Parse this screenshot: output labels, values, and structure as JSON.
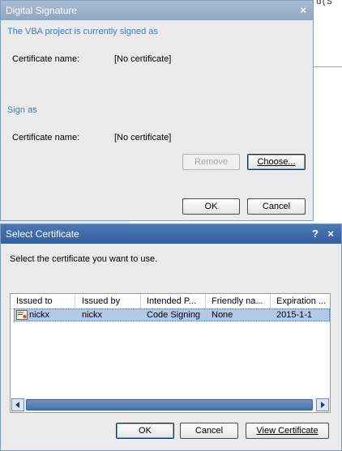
{
  "background": {
    "code_snippet": "d(S"
  },
  "digital_signature": {
    "title": "Digital Signature",
    "close_glyph": "×",
    "signed_as_heading": "The VBA project is currently signed as",
    "cert_label_1": "Certificate name:",
    "cert_value_1": "[No certificate]",
    "sign_as_heading": "Sign as",
    "cert_label_2": "Certificate name:",
    "cert_value_2": "[No certificate]",
    "remove_label": "Remove",
    "choose_label": "Choose...",
    "ok_label": "OK",
    "cancel_label": "Cancel"
  },
  "select_certificate": {
    "title": "Select Certificate",
    "help_glyph": "?",
    "close_glyph": "×",
    "instruction": "Select the certificate you want to use.",
    "columns": [
      "Issued to",
      "Issued by",
      "Intended P...",
      "Friendly na...",
      "Expiration ..."
    ],
    "rows": [
      {
        "issued_to": "nickx",
        "issued_by": "nickx",
        "intended": "Code Signing",
        "friendly": "None",
        "expiration": "2015-1-1"
      }
    ],
    "ok_label": "OK",
    "cancel_label": "Cancel",
    "view_label": "View Certificate"
  },
  "colors": {
    "section_heading": "#3c7ac8",
    "selection": "#b3c9e8",
    "active_title": "#33609f",
    "inactive_title": "#8ea7c4"
  }
}
